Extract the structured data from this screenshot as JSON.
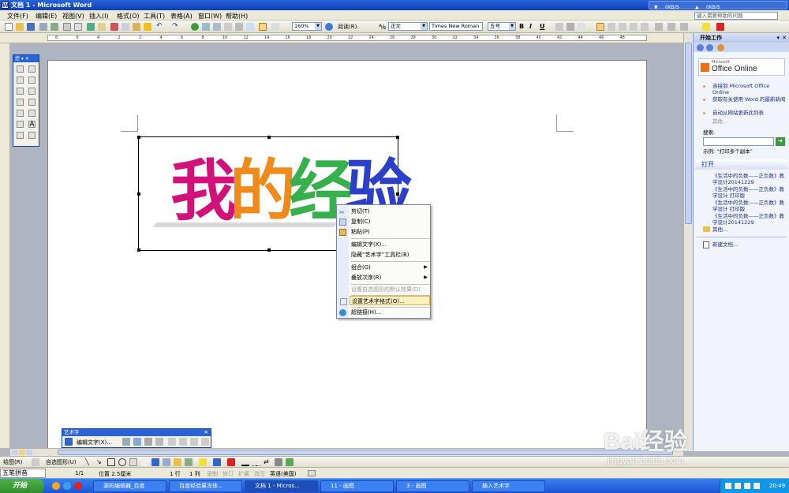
{
  "window": {
    "title": "文档 1 - Microsoft Word",
    "net_down": "0KB/S",
    "net_up": "0KB/S"
  },
  "menu": {
    "items": [
      "文件(F)",
      "编辑(E)",
      "视图(V)",
      "插入(I)",
      "格式(O)",
      "工具(T)",
      "表格(A)",
      "窗口(W)",
      "帮助(H)"
    ],
    "help_box": "键入需要帮助的问题"
  },
  "toolbar": {
    "zoom": "160%",
    "read": "阅读(R)",
    "style": "正文",
    "font": "Times New Roman",
    "size": "五号",
    "bold": "B",
    "italic": "I",
    "underline": "U"
  },
  "ruler": {
    "numbers": [
      "8",
      "6",
      "4",
      "2",
      "2",
      "4",
      "6",
      "8",
      "10",
      "12",
      "14",
      "16",
      "18",
      "20",
      "22",
      "24",
      "26",
      "28",
      "30",
      "32",
      "34",
      "36",
      "38",
      "40",
      "42",
      "44",
      "46",
      "48"
    ]
  },
  "float_toolbar": {
    "title": "控"
  },
  "wordart": {
    "chars": [
      "我",
      "的",
      "经",
      "验"
    ],
    "colors": [
      "#d2127a",
      "#f08a1a",
      "#36b04a",
      "#2b3fc8"
    ]
  },
  "context_menu": {
    "items": [
      {
        "label": "剪切(T)",
        "disabled": false
      },
      {
        "label": "复制(C)",
        "disabled": false
      },
      {
        "label": "粘贴(P)",
        "disabled": false
      },
      {
        "label": "编辑文字(X)...",
        "disabled": false
      },
      {
        "label": "隐藏“艺术字”工具栏(B)",
        "disabled": false
      },
      {
        "label": "组合(G)",
        "disabled": false,
        "submenu": true
      },
      {
        "label": "叠放次序(R)",
        "disabled": false,
        "submenu": true
      },
      {
        "label": "设置自选图形的默认效果(D)",
        "disabled": true
      },
      {
        "label": "设置艺术字格式(O)...",
        "disabled": false,
        "highlighted": true
      },
      {
        "label": "超链接(H)...",
        "disabled": false
      }
    ]
  },
  "wordart_toolbar": {
    "title": "艺术字",
    "edit_text": "编辑文字(X)..."
  },
  "task_pane": {
    "title": "开始工作",
    "brand_small": "Microsoft",
    "brand": "Office Online",
    "links": [
      "连接到 Microsoft Office Online",
      "获取有关使用 Word 的最新新闻",
      "自动从网站更新此列表"
    ],
    "more": "其他...",
    "search_label": "搜索:",
    "example": "示例: “打印多个副本”",
    "open_header": "打开",
    "recent_files": [
      "《生活中的负数——正负数》教学设计20141229",
      "《生活中的负数——正负数》教学设计 打印版",
      "《生活中的负数——正负数》教学设计 打印版",
      "《生活中的负数——正负数》教学设计20141229"
    ],
    "more_files": "其他...",
    "new_doc": "新建文档..."
  },
  "drawbar": {
    "draw": "绘图(R)",
    "autoshapes": "自选图形(U)"
  },
  "statusbar": {
    "ime": "五笔拼音",
    "page": "1/1",
    "position": "位置 2.5厘米",
    "line": "1 行",
    "col": "1 列",
    "modes": [
      "录制",
      "修订",
      "扩展",
      "改写"
    ],
    "language": "英语(美国)"
  },
  "taskbar": {
    "start": "开始",
    "tasks": [
      "源码编辑器_百度",
      "百度经验果冻体...",
      "文档 1 - Micros...",
      "11 - 画图",
      "3 - 画图",
      "插入艺术字"
    ],
    "clock": "20:49"
  },
  "watermark": {
    "brand": "Bai经验",
    "url": "jingyan.baidu.com"
  }
}
